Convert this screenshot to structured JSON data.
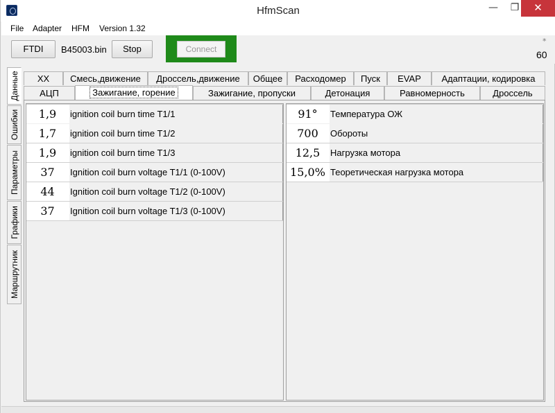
{
  "window": {
    "title": "HfmScan",
    "min_glyph": "—",
    "max_glyph": "❐",
    "close_glyph": "✕"
  },
  "menu": [
    "File",
    "Adapter",
    "HFM",
    "Version 1.32"
  ],
  "toolbar": {
    "ftdi_label": "FTDI",
    "file_name": "B45003.bin",
    "stop_label": "Stop",
    "connect_label": "Connect",
    "asterisk": "*",
    "counter": "60",
    "connect_highlight_color": "#1f8a1a"
  },
  "side_tabs": [
    "Данные",
    "Ошибки",
    "Параметры",
    "Графики",
    "Маршрутник"
  ],
  "tabs_top": [
    "XX",
    "Смесь,движение",
    "Дроссель,движение",
    "Общее",
    "Расходомер",
    "Пуск",
    "EVAP",
    "Адаптации, кодировка"
  ],
  "tabs_bottom": [
    "АЦП",
    "Зажигание, горение",
    "Зажигание, пропуски",
    "Детонация",
    "Равномерность",
    "Дроссель"
  ],
  "active_tab": "Зажигание, горение",
  "left_rows": [
    {
      "value": "1,9",
      "label": "ignition coil burn time T1/1"
    },
    {
      "value": "1,7",
      "label": "ignition coil burn time T1/2"
    },
    {
      "value": "1,9",
      "label": "ignition coil burn time T1/3"
    },
    {
      "value": "37",
      "label": "Ignition coil burn voltage T1/1 (0-100V)"
    },
    {
      "value": "44",
      "label": "Ignition coil burn voltage T1/2 (0-100V)"
    },
    {
      "value": "37",
      "label": "Ignition coil burn voltage T1/3 (0-100V)"
    }
  ],
  "right_rows": [
    {
      "value": "91°",
      "label": "Температура ОЖ"
    },
    {
      "value": "700",
      "label": "Обороты"
    },
    {
      "value": "12,5",
      "label": "Нагрузка мотора"
    },
    {
      "value": "15,0%",
      "label": "Теоретическая нагрузка мотора"
    }
  ]
}
